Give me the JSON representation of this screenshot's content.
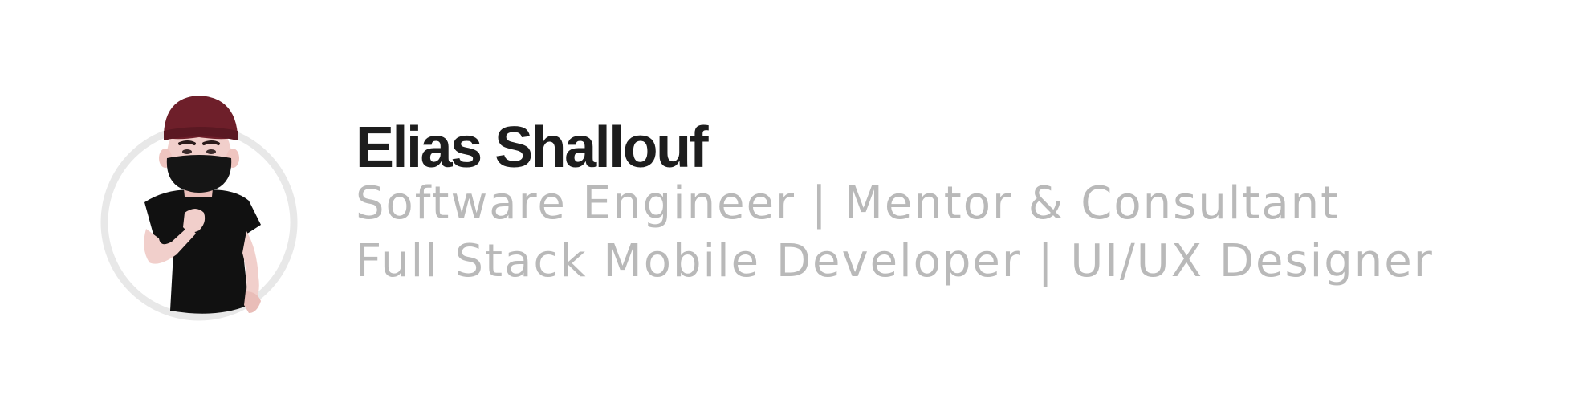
{
  "profile": {
    "name": "Elias Shallouf",
    "roles": [
      "Software Engineer | Mentor & Consultant",
      "Full Stack Mobile Developer | UI/UX Designer"
    ]
  },
  "avatar": {
    "icon": "memoji-avatar-icon",
    "ring_color": "#e8e8e8",
    "beanie_color": "#6e1f2a",
    "shirt_color": "#111111",
    "mask_color": "#151515",
    "skin_color": "#f1cfcb"
  },
  "colors": {
    "name": "#1d1d1d",
    "roles": "#b9b9b9",
    "background": "#ffffff"
  }
}
